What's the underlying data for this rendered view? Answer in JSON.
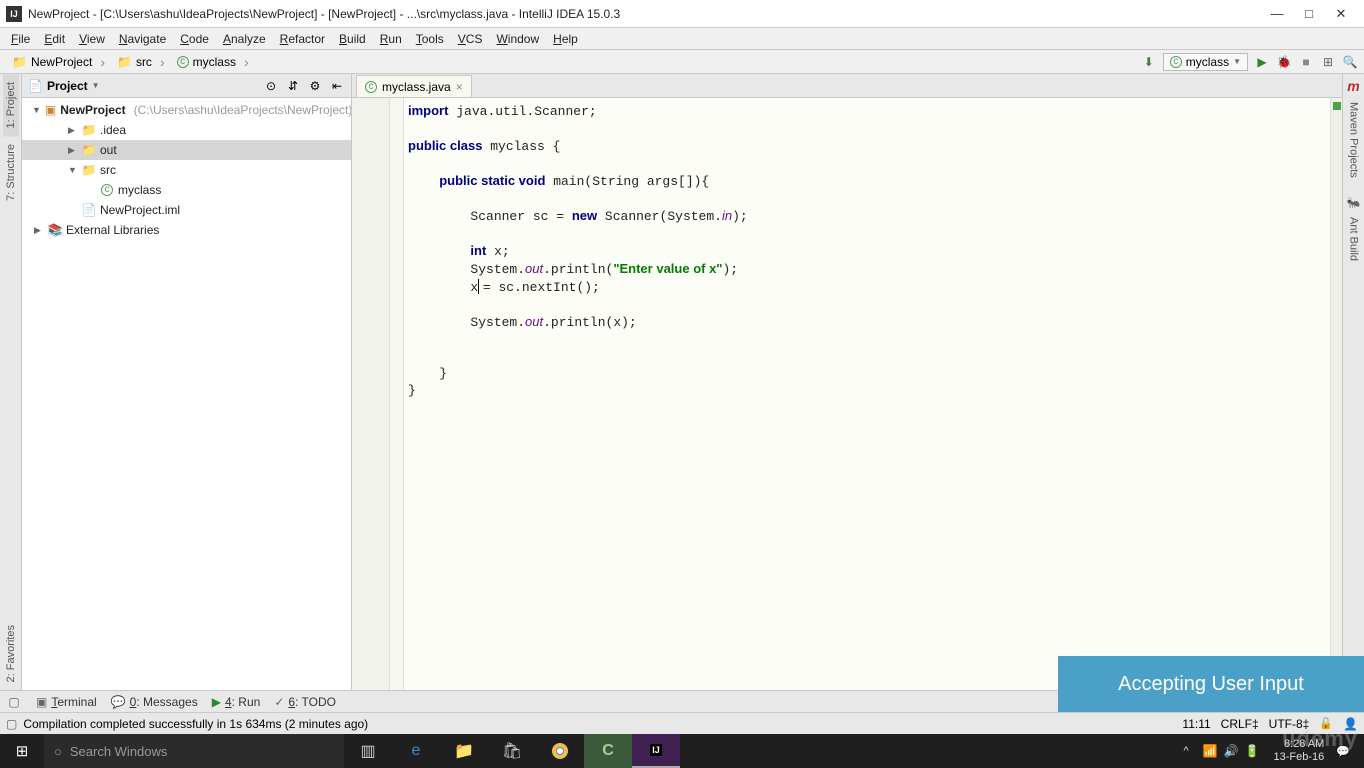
{
  "titlebar": {
    "text": "NewProject - [C:\\Users\\ashu\\IdeaProjects\\NewProject] - [NewProject] - ...\\src\\myclass.java - IntelliJ IDEA 15.0.3"
  },
  "menus": [
    "File",
    "Edit",
    "View",
    "Navigate",
    "Code",
    "Analyze",
    "Refactor",
    "Build",
    "Run",
    "Tools",
    "VCS",
    "Window",
    "Help"
  ],
  "breadcrumb": {
    "items": [
      {
        "icon": "folder",
        "label": "NewProject"
      },
      {
        "icon": "folder",
        "label": "src"
      },
      {
        "icon": "class",
        "label": "myclass"
      }
    ]
  },
  "run_config": {
    "label": "myclass"
  },
  "left_tabs": [
    "1: Project",
    "7: Structure"
  ],
  "left_tabs_bottom": [
    "2: Favorites"
  ],
  "right_tabs": [
    "Maven Projects",
    "Ant Build"
  ],
  "project_panel": {
    "title": "Project",
    "root": {
      "label": "NewProject",
      "path": "(C:\\Users\\ashu\\IdeaProjects\\NewProject)"
    },
    "nodes": [
      {
        "depth": 1,
        "arrow": "▶",
        "icon": "folder",
        "label": ".idea"
      },
      {
        "depth": 1,
        "arrow": "▶",
        "icon": "folder",
        "label": "out",
        "selected": true
      },
      {
        "depth": 1,
        "arrow": "▼",
        "icon": "folder",
        "label": "src"
      },
      {
        "depth": 2,
        "arrow": "",
        "icon": "class",
        "label": "myclass"
      },
      {
        "depth": 1,
        "arrow": "",
        "icon": "file",
        "label": "NewProject.iml"
      }
    ],
    "ext_lib": "External Libraries"
  },
  "editor": {
    "tab": "myclass.java",
    "code_lines": [
      {
        "t": "import java.util.Scanner;",
        "kind": "plain"
      },
      {
        "t": "",
        "kind": "plain"
      },
      {
        "t": "public class myclass {",
        "kind": "class"
      },
      {
        "t": "",
        "kind": "plain"
      },
      {
        "t": "    public static void main(String args[]){",
        "kind": "method"
      },
      {
        "t": "",
        "kind": "plain"
      },
      {
        "t": "        Scanner sc = new Scanner(System.in);",
        "kind": "scanner"
      },
      {
        "t": "",
        "kind": "plain"
      },
      {
        "t": "        int x;",
        "kind": "intx"
      },
      {
        "t": "        System.out.println(\"Enter value of x\");",
        "kind": "println1"
      },
      {
        "t": "        x = sc.nextInt();",
        "kind": "assign",
        "cursor": true
      },
      {
        "t": "",
        "kind": "plain"
      },
      {
        "t": "        System.out.println(x);",
        "kind": "println2"
      },
      {
        "t": "",
        "kind": "plain"
      },
      {
        "t": "",
        "kind": "plain"
      },
      {
        "t": "    }",
        "kind": "plain"
      },
      {
        "t": "}",
        "kind": "plain"
      }
    ]
  },
  "bottom_tools": [
    {
      "icon": "▣",
      "label": "Terminal"
    },
    {
      "icon": "💬",
      "label": "0: Messages"
    },
    {
      "icon": "▶",
      "label": "4: Run",
      "color": "#2a8a2a"
    },
    {
      "icon": "✓",
      "label": "6: TODO"
    }
  ],
  "status": {
    "msg": "Compilation completed successfully in 1s 634ms (2 minutes ago)",
    "pos": "11:11",
    "sep": "CRLF‡",
    "enc": "UTF-8‡"
  },
  "overlay": "Accepting User Input",
  "taskbar": {
    "search_placeholder": "Search Windows",
    "time": "8:28 AM",
    "date": "13-Feb-16"
  },
  "watermark": "udemy"
}
